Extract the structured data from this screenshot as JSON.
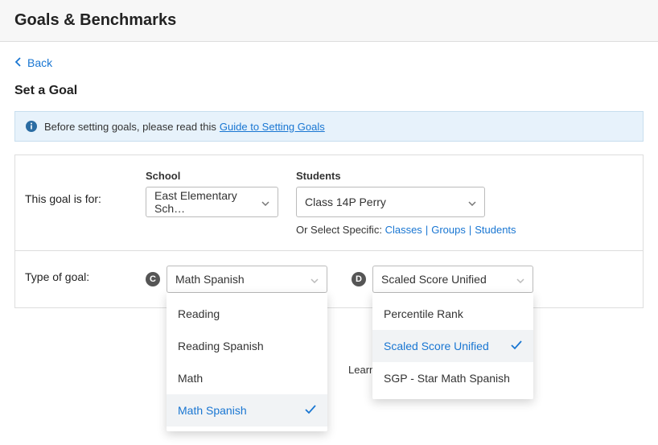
{
  "header": {
    "title": "Goals & Benchmarks"
  },
  "back": {
    "label": "Back"
  },
  "subheading": "Set a Goal",
  "info": {
    "text": "Before setting goals, please read this",
    "link": "Guide to Setting Goals"
  },
  "goalFor": {
    "label": "This goal is for:",
    "school": {
      "label": "School",
      "value": "East Elementary Sch…"
    },
    "students": {
      "label": "Students",
      "value": "Class 14P Perry",
      "helperPrefix": "Or Select Specific:",
      "links": {
        "classes": "Classes",
        "groups": "Groups",
        "students": "Students"
      }
    }
  },
  "typeOfGoal": {
    "label": "Type of goal:",
    "badges": {
      "c": "C",
      "d": "D"
    },
    "subject": {
      "value": "Math Spanish",
      "options": [
        "Reading",
        "Reading Spanish",
        "Math",
        "Math Spanish"
      ],
      "selectedIndex": 3
    },
    "metric": {
      "value": "Scaled Score Unified",
      "options": [
        "Percentile Rank",
        "Scaled Score Unified",
        "SGP - Star Math Spanish"
      ],
      "selectedIndex": 1
    }
  },
  "learn": "Learn"
}
